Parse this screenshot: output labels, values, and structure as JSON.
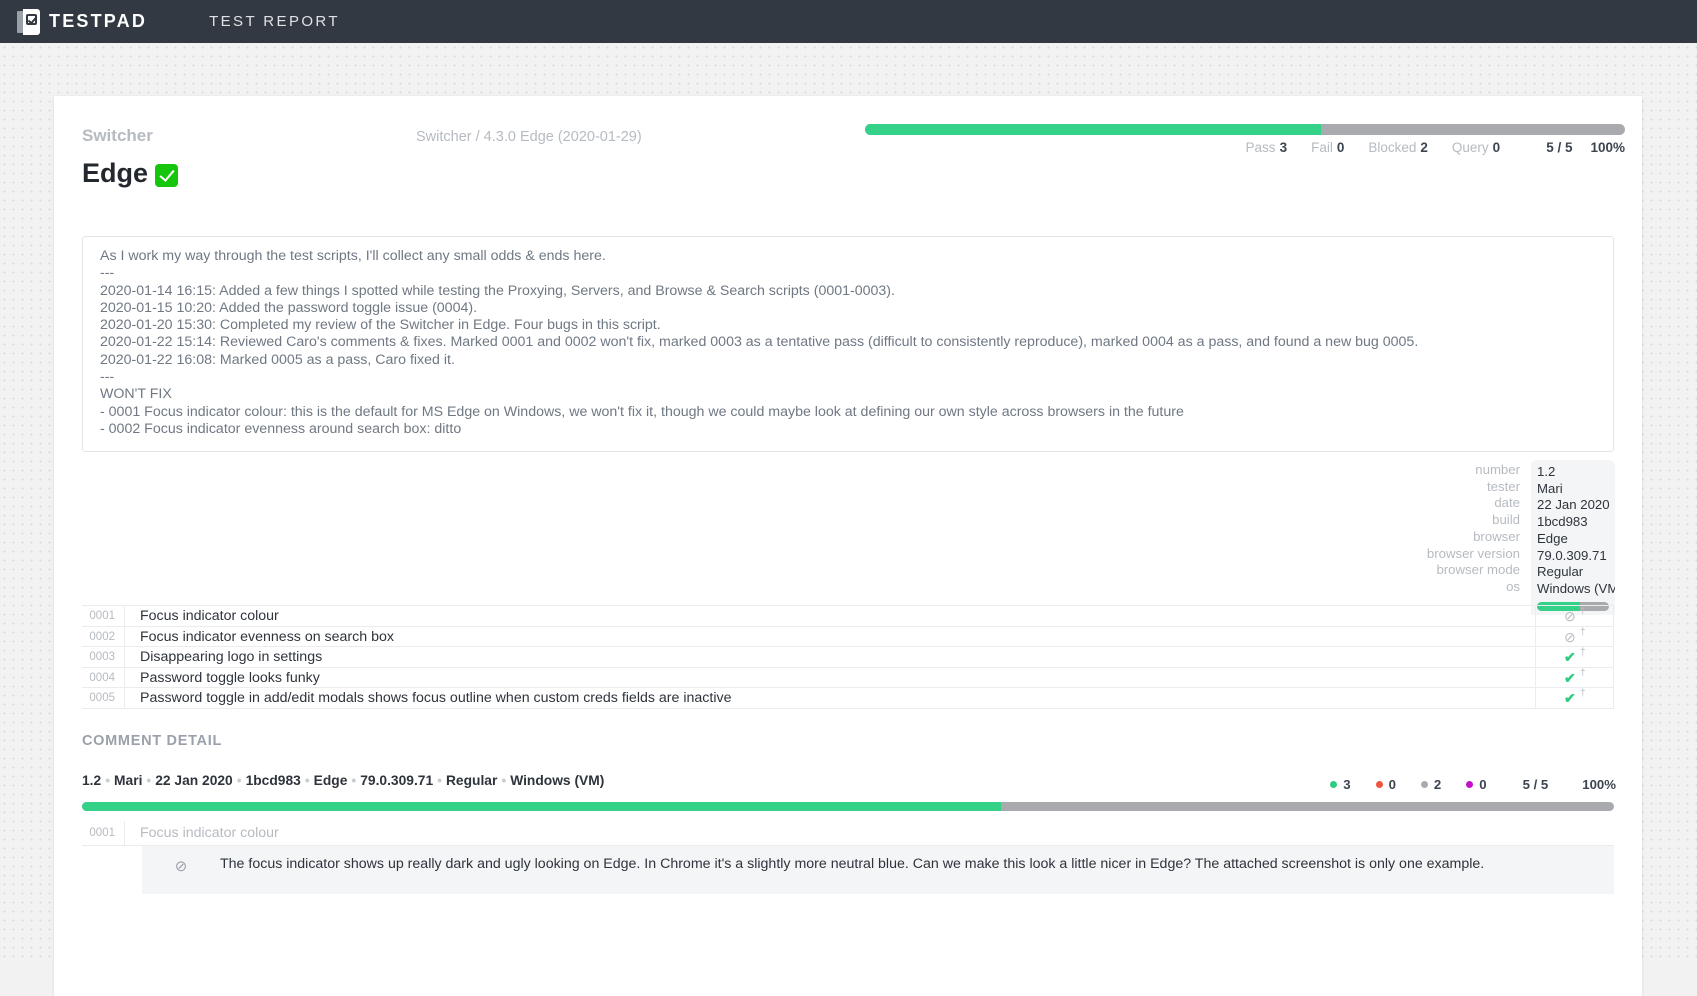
{
  "topbar": {
    "brand": "TESTPAD",
    "nav_label": "TEST REPORT",
    "logo_icon": "testpad-logo-icon"
  },
  "header": {
    "project_name": "Switcher",
    "breadcrumb": "Switcher / 4.3.0 Edge (2020-01-29)",
    "script_title": "Edge",
    "script_badge_icon": "green-check-badge-icon",
    "progress": {
      "pass_pct": 60,
      "blocked_pct": 40
    },
    "stats": {
      "pass_label": "Pass",
      "pass_value": "3",
      "fail_label": "Fail",
      "fail_value": "0",
      "blocked_label": "Blocked",
      "blocked_value": "2",
      "query_label": "Query",
      "query_value": "0",
      "fraction": "5 / 5",
      "percent": "100%"
    }
  },
  "notes": {
    "lines": [
      "As I work my way through the test scripts, I'll collect any small odds & ends here.",
      "---",
      "2020-01-14 16:15: Added a few things I spotted while testing the Proxying, Servers, and Browse & Search scripts (0001-0003).",
      "2020-01-15 10:20: Added the password toggle issue (0004).",
      "2020-01-20 15:30: Completed my review of the Switcher in Edge. Four bugs in this script.",
      "2020-01-22 15:14: Reviewed Caro's comments & fixes. Marked 0001 and 0002 won't fix, marked 0003 as a tentative pass (difficult to consistently reproduce), marked 0004 as a pass, and found a new bug 0005.",
      "2020-01-22 16:08: Marked 0005 as a pass, Caro fixed it.",
      "---",
      "WON'T FIX",
      "- 0001 Focus indicator colour: this is the default for MS Edge on Windows, we won't fix it, though we could maybe look at defining our own style across browsers in the future",
      "- 0002 Focus indicator evenness around search box: ditto"
    ]
  },
  "meta": {
    "labels": [
      "number",
      "tester",
      "date",
      "build",
      "browser",
      "browser version",
      "browser mode",
      "os"
    ],
    "values": [
      "1.2",
      "Mari",
      "22 Jan 2020",
      "1bcd983",
      "Edge",
      "79.0.309.71",
      "Regular",
      "Windows (VM)"
    ],
    "minibar_pass_pct": 60
  },
  "test_rows": [
    {
      "number": "0001",
      "text": "Focus indicator colour",
      "status": "blocked",
      "status_icon": "blocked-circle-icon",
      "glyph": "⊘",
      "dagger": "†"
    },
    {
      "number": "0002",
      "text": "Focus indicator evenness on search box",
      "status": "blocked",
      "status_icon": "blocked-circle-icon",
      "glyph": "⊘",
      "dagger": "†"
    },
    {
      "number": "0003",
      "text": "Disappearing logo in settings",
      "status": "pass",
      "status_icon": "check-icon",
      "glyph": "✔",
      "dagger": "†"
    },
    {
      "number": "0004",
      "text": "Password toggle looks funky",
      "status": "pass",
      "status_icon": "check-icon",
      "glyph": "✔",
      "dagger": "†"
    },
    {
      "number": "0005",
      "text": "Password toggle in add/edit modals shows focus outline when custom creds fields are inactive",
      "status": "pass",
      "status_icon": "check-icon",
      "glyph": "✔",
      "dagger": "†"
    }
  ],
  "comment_detail": {
    "section_title": "COMMENT DETAIL",
    "meta_parts": [
      "1.2",
      "Mari",
      "22 Jan 2020",
      "1bcd983",
      "Edge",
      "79.0.309.71",
      "Regular",
      "Windows (VM)"
    ],
    "separator": "•",
    "stats": {
      "pass_color": "#2ecc80",
      "pass_value": "3",
      "fail_color": "#f0533f",
      "fail_value": "0",
      "blocked_color": "#a8aaad",
      "blocked_value": "2",
      "query_color": "#c510c5",
      "query_value": "0",
      "fraction": "5 / 5",
      "percent": "100%"
    },
    "progress": {
      "pass_pct": 60
    },
    "row": {
      "number": "0001",
      "text": "Focus indicator colour",
      "status_icon": "blocked-circle-icon",
      "glyph": "⊘",
      "comment": "The focus indicator shows up really dark and ugly looking on Edge. In Chrome it's a slightly more neutral blue. Can we make this look a little nicer in Edge? The attached screenshot is only one example."
    }
  },
  "colors": {
    "topbar_bg": "#333942",
    "pass_green": "#34d188",
    "neutral_gray": "#a8aaad",
    "muted_text": "#b6bbc1",
    "body_text": "#2e343c"
  }
}
